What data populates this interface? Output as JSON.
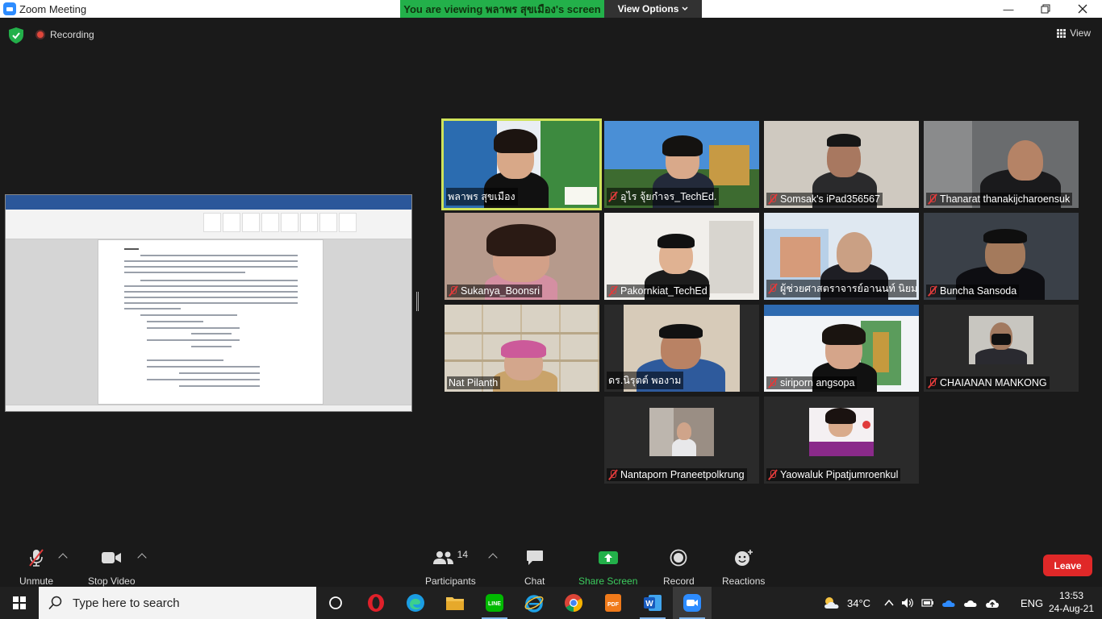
{
  "window": {
    "title": "Zoom Meeting"
  },
  "banner": {
    "viewing_text": "You are viewing พลาพร สุขเมือง's screen",
    "view_options": "View Options"
  },
  "topbar": {
    "recording": "Recording",
    "view": "View"
  },
  "participants": [
    {
      "name": "พลาพร สุขเมือง",
      "muted": false,
      "active": true
    },
    {
      "name": "อุไร จุ้ยกำจร_TechEd.",
      "muted": true
    },
    {
      "name": "Somsak's iPad356567",
      "muted": true
    },
    {
      "name": "Thanarat thanakijcharoensuk",
      "muted": true
    },
    {
      "name": "Sukanya_Boonsri",
      "muted": true
    },
    {
      "name": "Pakornkiat_TechEd",
      "muted": true
    },
    {
      "name": "ผู้ช่วยศาสตราจารย์อานนท์ นิยม...",
      "muted": true
    },
    {
      "name": "Buncha Sansoda",
      "muted": true
    },
    {
      "name": "Nat Pilanth",
      "muted": false
    },
    {
      "name": "ดร.นิรุตต์ พองาม",
      "muted": false
    },
    {
      "name": "siriporn angsopa",
      "muted": true
    },
    {
      "name": "CHAIANAN MANKONG",
      "muted": true
    },
    {
      "name": "Nantaporn Praneetpolkrung",
      "muted": true
    },
    {
      "name": "Yaowaluk Pipatjumroenkul",
      "muted": true
    }
  ],
  "toolbar": {
    "unmute": "Unmute",
    "stop_video": "Stop Video",
    "participants": "Participants",
    "participants_count": "14",
    "chat": "Chat",
    "share_screen": "Share Screen",
    "record": "Record",
    "reactions": "Reactions",
    "leave": "Leave"
  },
  "taskbar": {
    "search_placeholder": "Type here to search",
    "temperature": "34°C",
    "language": "ENG",
    "time": "13:53",
    "date": "24-Aug-21"
  },
  "colors": {
    "share_green": "#23b04a",
    "leave_red": "#e02828",
    "active_border": "#cfe35a"
  }
}
